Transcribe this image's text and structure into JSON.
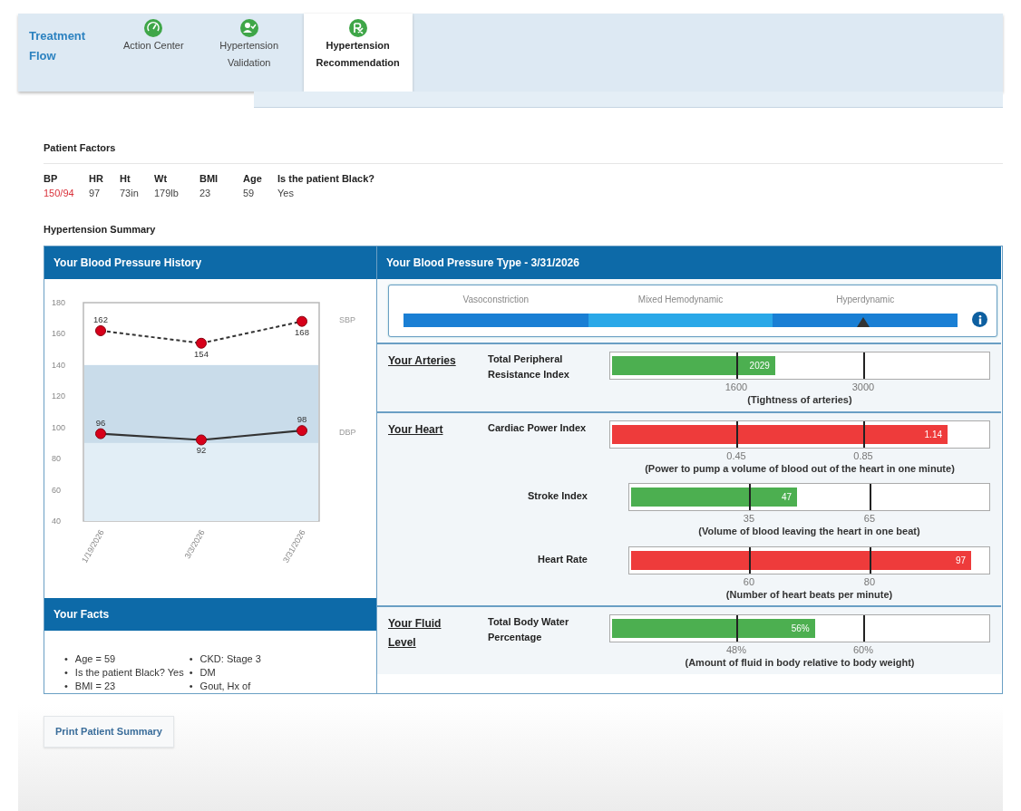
{
  "nav": {
    "title": "Treatment Flow",
    "steps": [
      {
        "label": "Action Center",
        "selected": false
      },
      {
        "label": "Hypertension Validation",
        "selected": false
      },
      {
        "label": "Hypertension Recommendation",
        "selected": true
      }
    ]
  },
  "patient_factors": {
    "title": "Patient Factors",
    "items": [
      {
        "label": "BP",
        "value": "150/94",
        "alert": true
      },
      {
        "label": "HR",
        "value": "97",
        "alert": false
      },
      {
        "label": "Ht",
        "value": "73in",
        "alert": false
      },
      {
        "label": "Wt",
        "value": "179lb",
        "alert": false
      },
      {
        "label": "BMI",
        "value": "23",
        "alert": false
      },
      {
        "label": "Age",
        "value": "59",
        "alert": false
      },
      {
        "label": "Is the patient Black?",
        "value": "Yes",
        "alert": false
      }
    ]
  },
  "summary_title": "Hypertension Summary",
  "history": {
    "title": "Your Blood Pressure History",
    "chart_data": {
      "type": "line",
      "categories": [
        "1/19/2026",
        "3/3/2026",
        "3/31/2026"
      ],
      "series": [
        {
          "name": "SBP",
          "color": "#333333",
          "line_style": "dashed",
          "marker": "circle",
          "values": [
            162,
            154,
            168
          ]
        },
        {
          "name": "DBP",
          "color": "#333333",
          "line_style": "solid",
          "marker": "circle",
          "values": [
            96,
            92,
            98
          ]
        }
      ],
      "ylim": [
        40,
        180
      ],
      "yticks": [
        40,
        60,
        80,
        100,
        120,
        140,
        160,
        180
      ],
      "data_labels": true,
      "bands": [
        {
          "axis": "y",
          "from": 90,
          "to": 140,
          "color": "#c9dcea"
        },
        {
          "axis": "y",
          "from": 40,
          "to": 90,
          "color": "#e2eef6"
        }
      ]
    }
  },
  "facts": {
    "title": "Your Facts",
    "bullet": "•",
    "columns": [
      [
        "Age = 59",
        "Is the patient Black? Yes",
        "BMI = 23"
      ],
      [
        "CKD: Stage 3",
        "DM",
        "Gout, Hx of"
      ]
    ]
  },
  "bp_type": {
    "title": "Your Blood Pressure Type - 3/31/2026",
    "segments": [
      "Vasoconstriction",
      "Mixed Hemodynamic",
      "Hyperdynamic"
    ],
    "level": 0.83
  },
  "sections": [
    {
      "title": "Your Arteries",
      "metrics": [
        {
          "label": "Total Peripheral Resistance Index",
          "value": "2029",
          "level": 0.435,
          "color": "#4caf50",
          "ticks": [
            "1600",
            "3000"
          ],
          "caption": "(Tightness of arteries)"
        }
      ]
    },
    {
      "title": "Your Heart",
      "metrics": [
        {
          "label": "Cardiac Power Index",
          "value": "1.14",
          "level": 0.89,
          "color": "#ee3b3b",
          "ticks": [
            "0.45",
            "0.85"
          ],
          "caption": "(Power to pump a volume of blood out of the heart in one minute)"
        },
        {
          "label": "Stroke Index",
          "value": "47",
          "level": 0.466,
          "color": "#4caf50",
          "ticks": [
            "35",
            "65"
          ],
          "caption": "(Volume of blood leaving the heart in one beat)"
        },
        {
          "label": "Heart Rate",
          "value": "97",
          "level": 0.95,
          "color": "#ee3b3b",
          "ticks": [
            "60",
            "80"
          ],
          "caption": "(Number of heart beats per minute)"
        }
      ]
    },
    {
      "title": "Your Fluid Level",
      "metrics": [
        {
          "label": "Total Body Water Percentage",
          "value": "56%",
          "level": 0.54,
          "color": "#4caf50",
          "ticks": [
            "48%",
            "60%"
          ],
          "caption": "(Amount of fluid in body relative to body weight)"
        }
      ]
    }
  ],
  "print_button": "Print Patient Summary"
}
